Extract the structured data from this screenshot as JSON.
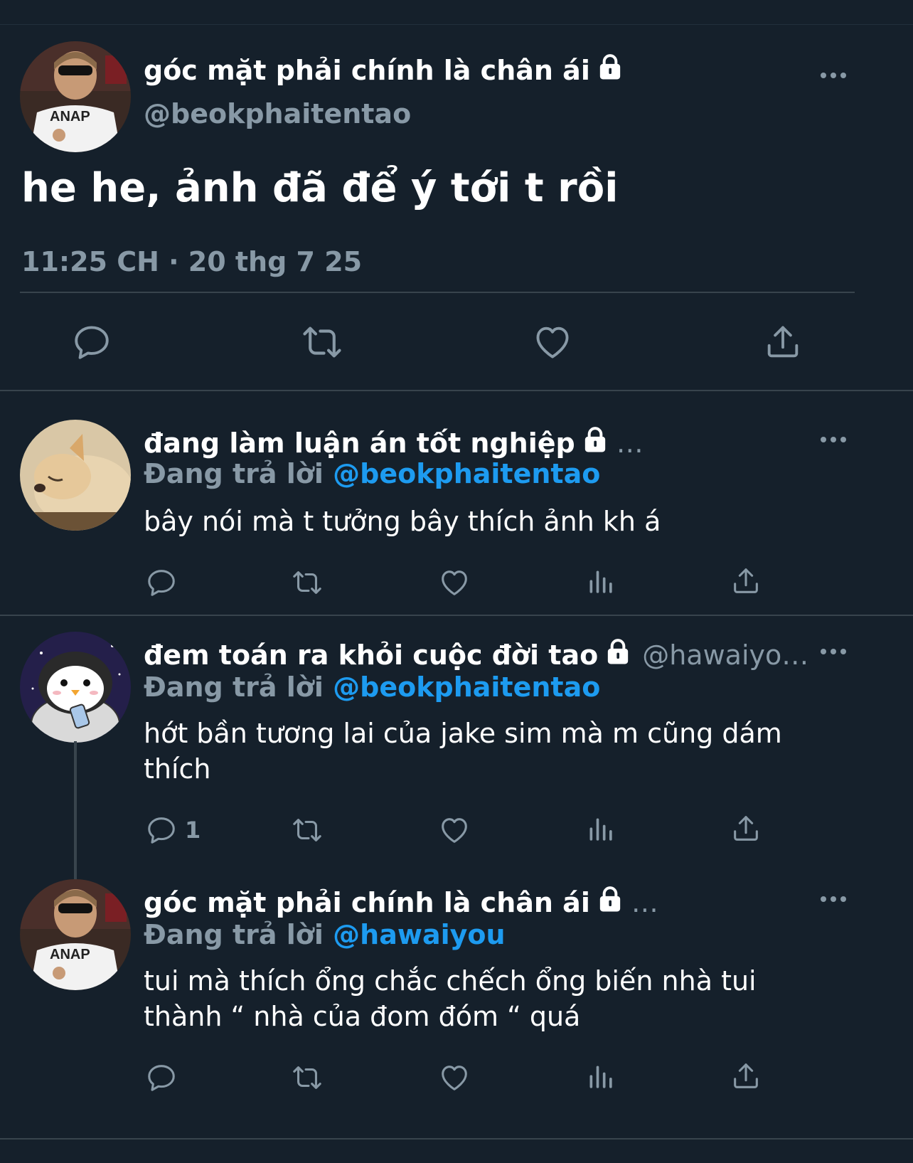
{
  "colors": {
    "background": "#15202b",
    "muted": "#8899a6",
    "mention": "#1d9bf0",
    "divider": "#38444d"
  },
  "main_tweet": {
    "display_name": "góc mặt phải chính là chân ái",
    "handle": "@beokphaitentao",
    "text": "he he, ảnh đã để ý tới t rồi",
    "timestamp": "11:25 CH · 20 thg 7 25",
    "actions": [
      "reply-icon",
      "retweet-icon",
      "like-icon",
      "share-icon"
    ]
  },
  "replies": [
    {
      "display_name": "đang làm luận án tốt nghiệp",
      "handle_truncated": "…",
      "replying_label": "Đang trả lời",
      "replying_to": "@beokphaitentao",
      "text": "bây nói mà t tưởng bây thích ảnh kh á",
      "reply_count": ""
    },
    {
      "display_name": "đem toán ra khỏi cuộc đời tao",
      "handle_truncated": "@hawaiyo…",
      "replying_label": "Đang trả lời",
      "replying_to": "@beokphaitentao",
      "text": "hớt bần tương lai của jake sim mà m cũng dám thích",
      "reply_count": "1"
    },
    {
      "display_name": "góc mặt phải chính là chân ái",
      "handle_truncated": "…",
      "replying_label": "Đang trả lời",
      "replying_to": "@hawaiyou",
      "text": "tui mà thích ổng chắc chếch ổng biến nhà tui thành “ nhà của đom đóm “ quá",
      "reply_count": ""
    }
  ]
}
